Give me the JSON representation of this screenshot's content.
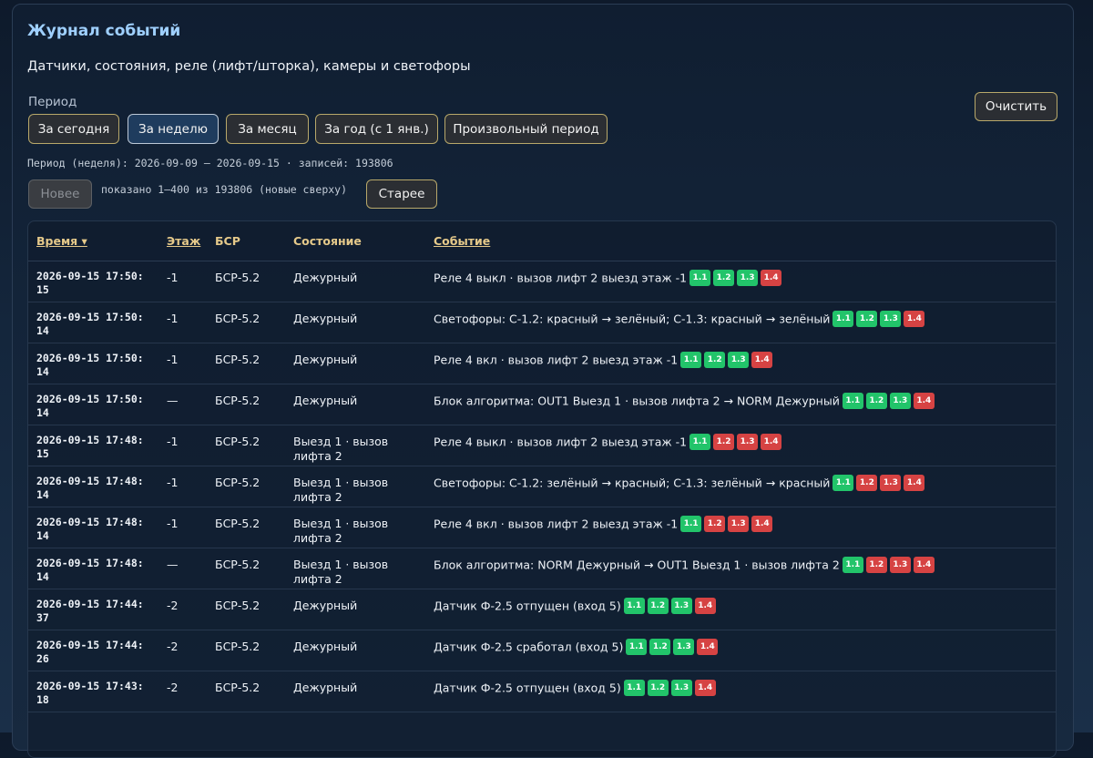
{
  "header": {
    "title": "Журнал событий",
    "subtitle": "Датчики, состояния, реле (лифт/шторка), камеры и светофоры"
  },
  "period": {
    "label": "Период",
    "buttons": [
      "За сегодня",
      "За неделю",
      "За месяц",
      "За год (с 1 янв.)",
      "Произвольный период"
    ],
    "active": "За неделю",
    "info": "Период (неделя): 2026-09-09 — 2026-09-15 · записей: 193806"
  },
  "clear_label": "Очистить",
  "pager": {
    "newer_label": "Новее",
    "shown": "показано 1–400 из 193806 (новые сверху)",
    "older_label": "Старее"
  },
  "table": {
    "columns": [
      "Время ▾",
      "Этаж",
      "БСР",
      "Состояние",
      "Событие"
    ],
    "rows": [
      {
        "time": "2026-09-15 17:50:\n15",
        "floor": "-1",
        "bsr": "БСР-5.2",
        "state": "Дежурный",
        "event": "Реле 4 выкл · вызов лифт 2 выезд этаж -1",
        "tags": [
          "g",
          "g",
          "g",
          "r"
        ]
      },
      {
        "time": "2026-09-15 17:50:\n14",
        "floor": "-1",
        "bsr": "БСР-5.2",
        "state": "Дежурный",
        "event": "Светофоры: С-1.2: красный → зелёный; С-1.3: красный → зелёный",
        "tags": [
          "g",
          "g",
          "g",
          "r"
        ]
      },
      {
        "time": "2026-09-15 17:50:\n14",
        "floor": "-1",
        "bsr": "БСР-5.2",
        "state": "Дежурный",
        "event": "Реле 4 вкл · вызов лифт 2 выезд этаж -1",
        "tags": [
          "g",
          "g",
          "g",
          "r"
        ]
      },
      {
        "time": "2026-09-15 17:50:\n14",
        "floor": "—",
        "bsr": "БСР-5.2",
        "state": "Дежурный",
        "event": "Блок алгоритма: OUT1 Выезд 1 · вызов лифта 2 → NORM Дежурный",
        "tags": [
          "g",
          "g",
          "g",
          "r"
        ]
      },
      {
        "time": "2026-09-15 17:48:\n15",
        "floor": "-1",
        "bsr": "БСР-5.2",
        "state": "Выезд 1 · вызов лифта 2",
        "event": "Реле 4 выкл · вызов лифт 2 выезд этаж -1",
        "tags": [
          "g",
          "r",
          "r",
          "r"
        ]
      },
      {
        "time": "2026-09-15 17:48:\n14",
        "floor": "-1",
        "bsr": "БСР-5.2",
        "state": "Выезд 1 · вызов лифта 2",
        "event": "Светофоры: С-1.2: зелёный → красный; С-1.3: зелёный → красный",
        "tags": [
          "g",
          "r",
          "r",
          "r"
        ]
      },
      {
        "time": "2026-09-15 17:48:\n14",
        "floor": "-1",
        "bsr": "БСР-5.2",
        "state": "Выезд 1 · вызов лифта 2",
        "event": "Реле 4 вкл · вызов лифт 2 выезд этаж -1",
        "tags": [
          "g",
          "r",
          "r",
          "r"
        ]
      },
      {
        "time": "2026-09-15 17:48:\n14",
        "floor": "—",
        "bsr": "БСР-5.2",
        "state": "Выезд 1 · вызов лифта 2",
        "event": "Блок алгоритма: NORM Дежурный → OUT1 Выезд 1 · вызов лифта 2",
        "tags": [
          "g",
          "r",
          "r",
          "r"
        ]
      },
      {
        "time": "2026-09-15 17:44:\n37",
        "floor": "-2",
        "bsr": "БСР-5.2",
        "state": "Дежурный",
        "event": "Датчик Ф-2.5 отпущен (вход 5)",
        "tags": [
          "g",
          "g",
          "g",
          "r"
        ]
      },
      {
        "time": "2026-09-15 17:44:\n26",
        "floor": "-2",
        "bsr": "БСР-5.2",
        "state": "Дежурный",
        "event": "Датчик Ф-2.5 сработал (вход 5)",
        "tags": [
          "g",
          "g",
          "g",
          "r"
        ]
      },
      {
        "time": "2026-09-15 17:43:\n18",
        "floor": "-2",
        "bsr": "БСР-5.2",
        "state": "Дежурный",
        "event": "Датчик Ф-2.5 отпущен (вход 5)",
        "tags": [
          "g",
          "g",
          "g",
          "r"
        ]
      }
    ],
    "tag_labels": [
      "1.1",
      "1.2",
      "1.3",
      "1.4"
    ],
    "colors": {
      "green": "#22c46a",
      "red": "#d64343"
    }
  }
}
